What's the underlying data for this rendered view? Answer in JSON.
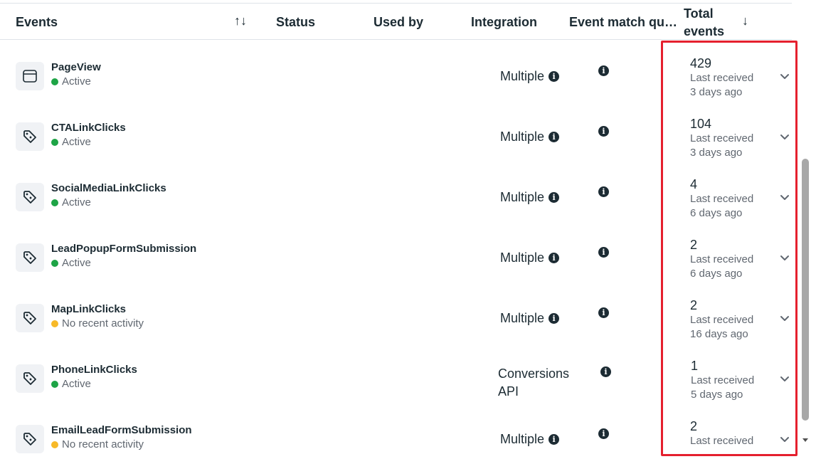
{
  "header": {
    "events": "Events",
    "sort_icon": "sort-arrows-icon",
    "status": "Status",
    "used_by": "Used by",
    "integration": "Integration",
    "event_match_quality": "Event match qual...",
    "total_events": "Total events",
    "sort_down_icon": "arrow-down-icon"
  },
  "colors": {
    "active": "#1ea446",
    "no_activity": "#f7b928",
    "highlight": "#e5202e"
  },
  "rows": [
    {
      "icon": "browser-window-icon",
      "name": "PageView",
      "status": "Active",
      "status_type": "active",
      "integration": "Multiple",
      "total": "429",
      "last_received_label": "Last received",
      "last_received": "3 days ago"
    },
    {
      "icon": "tag-icon",
      "name": "CTALinkClicks",
      "status": "Active",
      "status_type": "active",
      "integration": "Multiple",
      "total": "104",
      "last_received_label": "Last received",
      "last_received": "3 days ago"
    },
    {
      "icon": "tag-icon",
      "name": "SocialMediaLinkClicks",
      "status": "Active",
      "status_type": "active",
      "integration": "Multiple",
      "total": "4",
      "last_received_label": "Last received",
      "last_received": "6 days ago"
    },
    {
      "icon": "tag-icon",
      "name": "LeadPopupFormSubmission",
      "status": "Active",
      "status_type": "active",
      "integration": "Multiple",
      "total": "2",
      "last_received_label": "Last received",
      "last_received": "6 days ago"
    },
    {
      "icon": "tag-icon",
      "name": "MapLinkClicks",
      "status": "No recent activity",
      "status_type": "none",
      "integration": "Multiple",
      "total": "2",
      "last_received_label": "Last received",
      "last_received": "16 days ago"
    },
    {
      "icon": "tag-icon",
      "name": "PhoneLinkClicks",
      "status": "Active",
      "status_type": "active",
      "integration": "Conversions API",
      "total": "1",
      "last_received_label": "Last received",
      "last_received": "5 days ago"
    },
    {
      "icon": "tag-icon",
      "name": "EmailLeadFormSubmission",
      "status": "No recent activity",
      "status_type": "none",
      "integration": "Multiple",
      "total": "2",
      "last_received_label": "Last received",
      "last_received": ""
    }
  ]
}
